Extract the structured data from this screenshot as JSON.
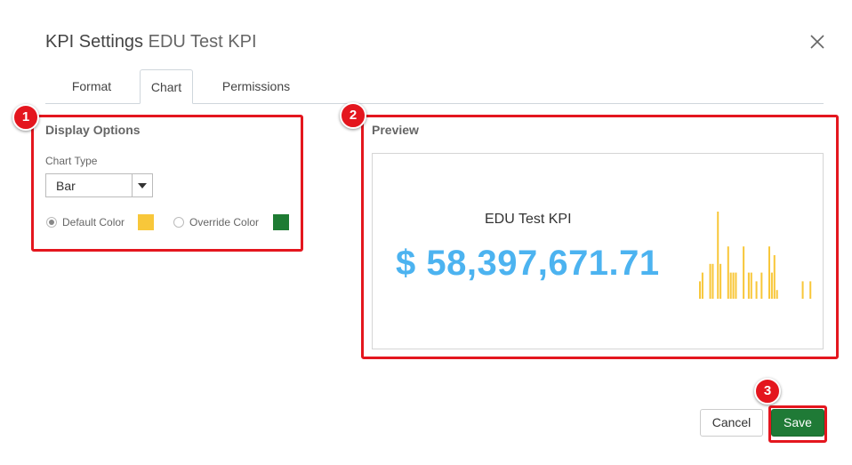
{
  "dialog": {
    "title_prefix": "KPI Settings",
    "title_kpi": "EDU Test KPI",
    "close_icon": "close-icon"
  },
  "tabs": [
    {
      "label": "Format",
      "active": false
    },
    {
      "label": "Chart",
      "active": true
    },
    {
      "label": "Permissions",
      "active": false
    }
  ],
  "display_options": {
    "title": "Display Options",
    "chart_type_label": "Chart Type",
    "chart_type_value": "Bar",
    "default_color_label": "Default Color",
    "override_color_label": "Override Color",
    "default_color": "#f8c73a",
    "override_color": "#1e7b33",
    "selected": "default"
  },
  "preview": {
    "title": "Preview",
    "kpi_name": "EDU Test KPI",
    "kpi_value": "$ 58,397,671.71",
    "bar_color": "#f8c73a",
    "bars": [
      2,
      3,
      0,
      0,
      4,
      4,
      0,
      10,
      4,
      0,
      0,
      6,
      3,
      3,
      3,
      0,
      0,
      6,
      0,
      3,
      3,
      0,
      2,
      0,
      3,
      0,
      0,
      6,
      3,
      5,
      1,
      0,
      0,
      0,
      0,
      0,
      0,
      0,
      0,
      0,
      2,
      0,
      0,
      2,
      0
    ]
  },
  "annotations": [
    "1",
    "2",
    "3"
  ],
  "footer": {
    "cancel_label": "Cancel",
    "save_label": "Save",
    "save_color": "#1f7a36"
  }
}
